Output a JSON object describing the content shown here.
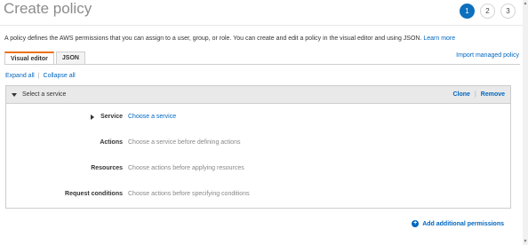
{
  "page": {
    "title": "Create policy"
  },
  "steps": [
    "1",
    "2",
    "3"
  ],
  "intro": {
    "text": "A policy defines the AWS permissions that you can assign to a user, group, or role. You can create and edit a policy in the visual editor and using JSON.",
    "link": "Learn more"
  },
  "tabs": [
    {
      "label": "Visual editor",
      "active": true
    },
    {
      "label": "JSON",
      "active": false
    }
  ],
  "import_link": "Import managed policy",
  "toolbar": {
    "expand": "Expand all",
    "collapse": "Collapse all"
  },
  "panel": {
    "title": "Select a service",
    "clone": "Clone",
    "remove": "Remove",
    "rows": [
      {
        "label": "Service",
        "value": "Choose a service"
      },
      {
        "label": "Actions",
        "value": "Choose a service before defining actions"
      },
      {
        "label": "Resources",
        "value": "Choose actions before applying resources"
      },
      {
        "label": "Request conditions",
        "value": "Choose actions before specifying conditions"
      }
    ]
  },
  "add_permissions": "Add additional permissions",
  "colors": {
    "accent": "#0066c0",
    "active_step": "#0d6fbd",
    "active_tab": "#ec7211"
  }
}
